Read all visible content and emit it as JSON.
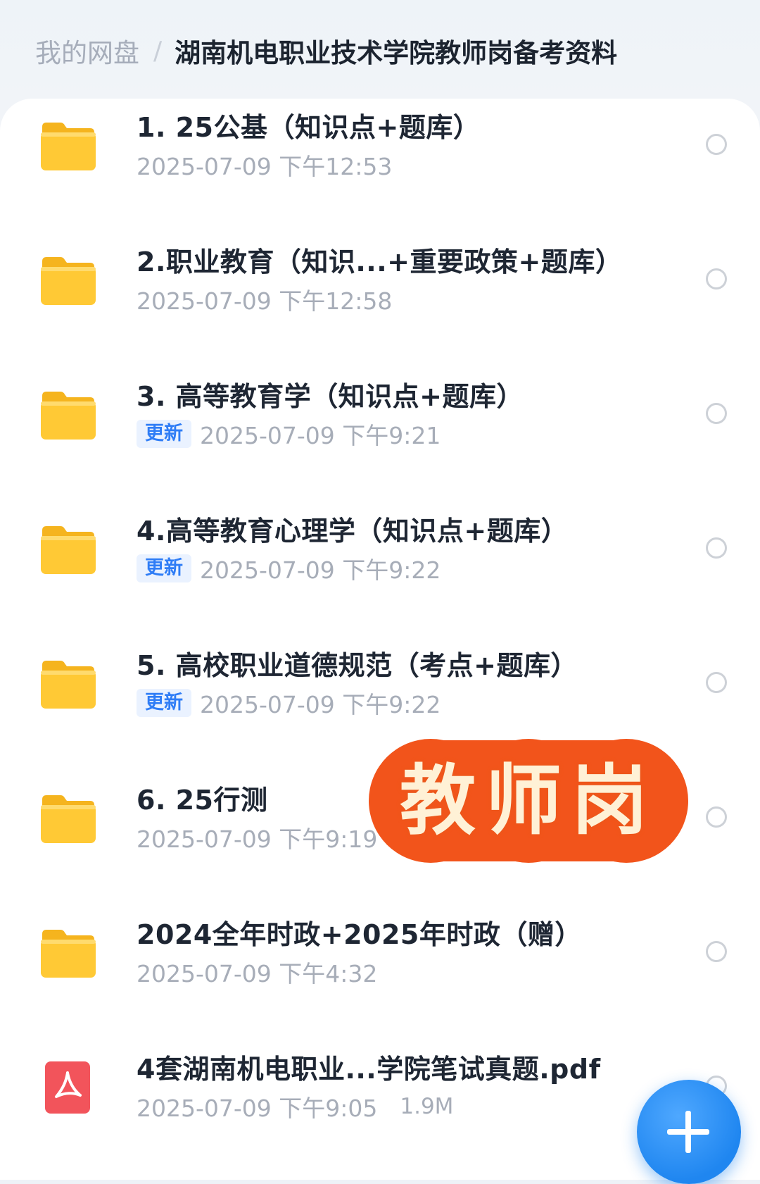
{
  "breadcrumb": {
    "root": "我的网盘",
    "separator": "/",
    "current": "湖南机电职业技术学院教师岗备考资料"
  },
  "files": [
    {
      "type": "folder",
      "icon": "folder-icon",
      "title": "1. 25公基（知识点+题库）",
      "badge": "",
      "date": "2025-07-09 下午12:53",
      "size": ""
    },
    {
      "type": "folder",
      "icon": "folder-icon",
      "title": "2.职业教育（知识...+重要政策+题库）",
      "badge": "",
      "date": "2025-07-09 下午12:58",
      "size": ""
    },
    {
      "type": "folder",
      "icon": "folder-icon",
      "title": "3. 高等教育学（知识点+题库）",
      "badge": "更新",
      "date": "2025-07-09 下午9:21",
      "size": ""
    },
    {
      "type": "folder",
      "icon": "folder-icon",
      "title": "4.高等教育心理学（知识点+题库）",
      "badge": "更新",
      "date": "2025-07-09 下午9:22",
      "size": ""
    },
    {
      "type": "folder",
      "icon": "folder-icon",
      "title": "5. 高校职业道德规范（考点+题库）",
      "badge": "更新",
      "date": "2025-07-09 下午9:22",
      "size": ""
    },
    {
      "type": "folder",
      "icon": "folder-icon",
      "title": "6. 25行测",
      "badge": "",
      "date": "2025-07-09 下午9:19",
      "size": ""
    },
    {
      "type": "folder",
      "icon": "folder-icon",
      "title": "2024全年时政+2025年时政（赠）",
      "badge": "",
      "date": "2025-07-09 下午4:32",
      "size": ""
    },
    {
      "type": "pdf",
      "icon": "pdf-icon",
      "title": "4套湖南机电职业...学院笔试真题.pdf",
      "badge": "",
      "date": "2025-07-09 下午9:05",
      "size": "1.9M"
    }
  ],
  "stamp": {
    "text": "教师岗"
  },
  "fab": {
    "icon": "plus-icon"
  },
  "colors": {
    "accent": "#2f7df6",
    "folder": "#ffc935",
    "pdf": "#f2545b",
    "stamp": "#f2541b"
  }
}
